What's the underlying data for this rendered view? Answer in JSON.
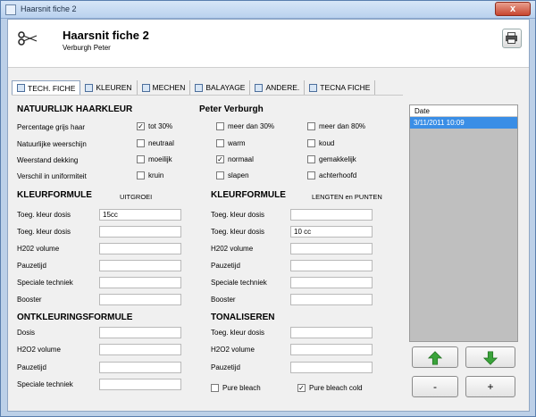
{
  "window": {
    "title": "Haarsnit fiche 2",
    "close_label": "x"
  },
  "header": {
    "title": "Haarsnit fiche 2",
    "subtitle": "Verburgh Peter",
    "print_icon": "printer-icon",
    "scissors_icon": "scissors-icon"
  },
  "tabs": [
    {
      "label": "TECH. FICHE",
      "icon": "tab-icon"
    },
    {
      "label": "KLEUREN",
      "icon": "tab-icon"
    },
    {
      "label": "MECHEN",
      "icon": "tab-icon"
    },
    {
      "label": "BALAYAGE",
      "icon": "tab-icon"
    },
    {
      "label": "ANDERE.",
      "icon": "tab-icon"
    },
    {
      "label": "TECNA FICHE",
      "icon": "tab-icon"
    }
  ],
  "natuurlijk": {
    "title": "NATUURLIJK HAARKLEUR",
    "name": "Peter  Verburgh",
    "rows": [
      {
        "label": "Percentage grijs haar",
        "options": [
          {
            "label": "tot 30%",
            "checked": true
          },
          {
            "label": "meer dan 30%",
            "checked": false
          },
          {
            "label": "meer dan 80%",
            "checked": false
          }
        ]
      },
      {
        "label": "Natuurlijke weerschijn",
        "options": [
          {
            "label": "neutraal",
            "checked": false
          },
          {
            "label": "warm",
            "checked": false
          },
          {
            "label": "koud",
            "checked": false
          }
        ]
      },
      {
        "label": "Weerstand dekking",
        "options": [
          {
            "label": "moeilijk",
            "checked": false
          },
          {
            "label": "normaal",
            "checked": true
          },
          {
            "label": "gemakkelijk",
            "checked": false
          }
        ]
      },
      {
        "label": "Verschil in uniformiteit",
        "options": [
          {
            "label": "kruin",
            "checked": false
          },
          {
            "label": "slapen",
            "checked": false
          },
          {
            "label": "achterhoofd",
            "checked": false
          }
        ]
      }
    ]
  },
  "kleur1": {
    "title": "KLEURFORMULE",
    "subtitle": "UITGROEI",
    "fields": [
      {
        "label": "Toeg. kleur dosis",
        "value": "15cc"
      },
      {
        "label": "Toeg. kleur dosis",
        "value": ""
      },
      {
        "label": "H202 volume",
        "value": ""
      },
      {
        "label": "Pauzetijd",
        "value": ""
      },
      {
        "label": "Speciale techniek",
        "value": ""
      },
      {
        "label": "Booster",
        "value": ""
      }
    ]
  },
  "kleur2": {
    "title": "KLEURFORMULE",
    "subtitle": "LENGTEN en PUNTEN",
    "fields": [
      {
        "label": "Toeg. kleur dosis",
        "value": ""
      },
      {
        "label": "Toeg. kleur dosis",
        "value": "10 cc"
      },
      {
        "label": "H202 volume",
        "value": ""
      },
      {
        "label": "Pauzetijd",
        "value": ""
      },
      {
        "label": "Speciale techniek",
        "value": ""
      },
      {
        "label": "Booster",
        "value": ""
      }
    ]
  },
  "ontkleuring": {
    "title": "ONTKLEURINGSFORMULE",
    "fields": [
      {
        "label": "Dosis",
        "value": ""
      },
      {
        "label": "H2O2 volume",
        "value": ""
      },
      {
        "label": "Pauzetijd",
        "value": ""
      },
      {
        "label": "Speciale techniek",
        "value": ""
      }
    ]
  },
  "tonaliseren": {
    "title": "TONALISEREN",
    "fields": [
      {
        "label": "Toeg. kleur dosis",
        "value": ""
      },
      {
        "label": "H2O2 volume",
        "value": ""
      },
      {
        "label": "Pauzetijd",
        "value": ""
      }
    ],
    "checks": [
      {
        "label": "Pure bleach",
        "checked": false
      },
      {
        "label": "Pure bleach cold",
        "checked": true
      }
    ]
  },
  "datelist": {
    "header": "Date",
    "rows": [
      "3/11/2011 10:09"
    ]
  },
  "buttons": {
    "up_icon": "arrow-up-icon",
    "down_icon": "arrow-down-icon",
    "minus": "-",
    "plus": "+"
  },
  "colors": {
    "accent": "#3a8ee6",
    "arrow_green": "#3aa33a"
  }
}
